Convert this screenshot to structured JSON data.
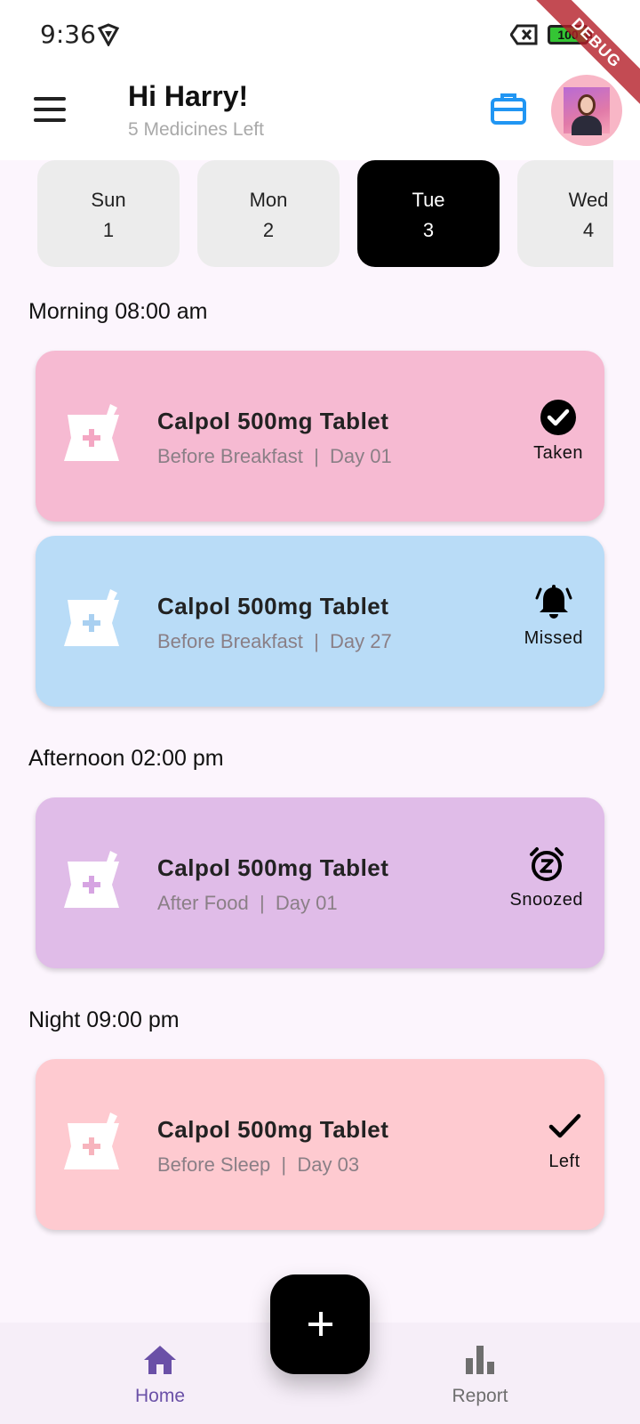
{
  "status_bar": {
    "time": "9:36",
    "battery": "100"
  },
  "debug_banner": "DEBUG",
  "header": {
    "greeting": "Hi Harry!",
    "subtitle": "5 Medicines Left"
  },
  "days": [
    {
      "name": "Sun",
      "num": "1"
    },
    {
      "name": "Mon",
      "num": "2"
    },
    {
      "name": "Tue",
      "num": "3",
      "selected": true
    },
    {
      "name": "Wed",
      "num": "4"
    }
  ],
  "sections": [
    {
      "title": "Morning 08:00 am",
      "meds": [
        {
          "name": "Calpol 500mg Tablet",
          "timing": "Before Breakfast",
          "day": "Day 01",
          "status": "Taken",
          "status_icon": "check-circle-icon",
          "bg": "#f6bad2",
          "accent": "#f4a7c3"
        },
        {
          "name": "Calpol 500mg Tablet",
          "timing": "Before Breakfast",
          "day": "Day 27",
          "status": "Missed",
          "status_icon": "bell-icon",
          "bg": "#b9dcf7",
          "accent": "#a9d0f1"
        }
      ]
    },
    {
      "title": "Afternoon 02:00 pm",
      "meds": [
        {
          "name": "Calpol 500mg Tablet",
          "timing": "After Food",
          "day": "Day 01",
          "status": "Snoozed",
          "status_icon": "snooze-alarm-icon",
          "bg": "#e0bce8",
          "accent": "#d6a4e2"
        }
      ]
    },
    {
      "title": "Night 09:00 pm",
      "meds": [
        {
          "name": "Calpol 500mg Tablet",
          "timing": "Before Sleep",
          "day": "Day 03",
          "status": "Left",
          "status_icon": "check-icon",
          "bg": "#fecad0",
          "accent": "#f7b4bd"
        }
      ]
    }
  ],
  "nav": {
    "home": "Home",
    "report": "Report"
  },
  "colors": {
    "nav_active": "#6a50a7",
    "nav_inactive": "#6e6e6e",
    "kit_blue": "#2196f3"
  }
}
